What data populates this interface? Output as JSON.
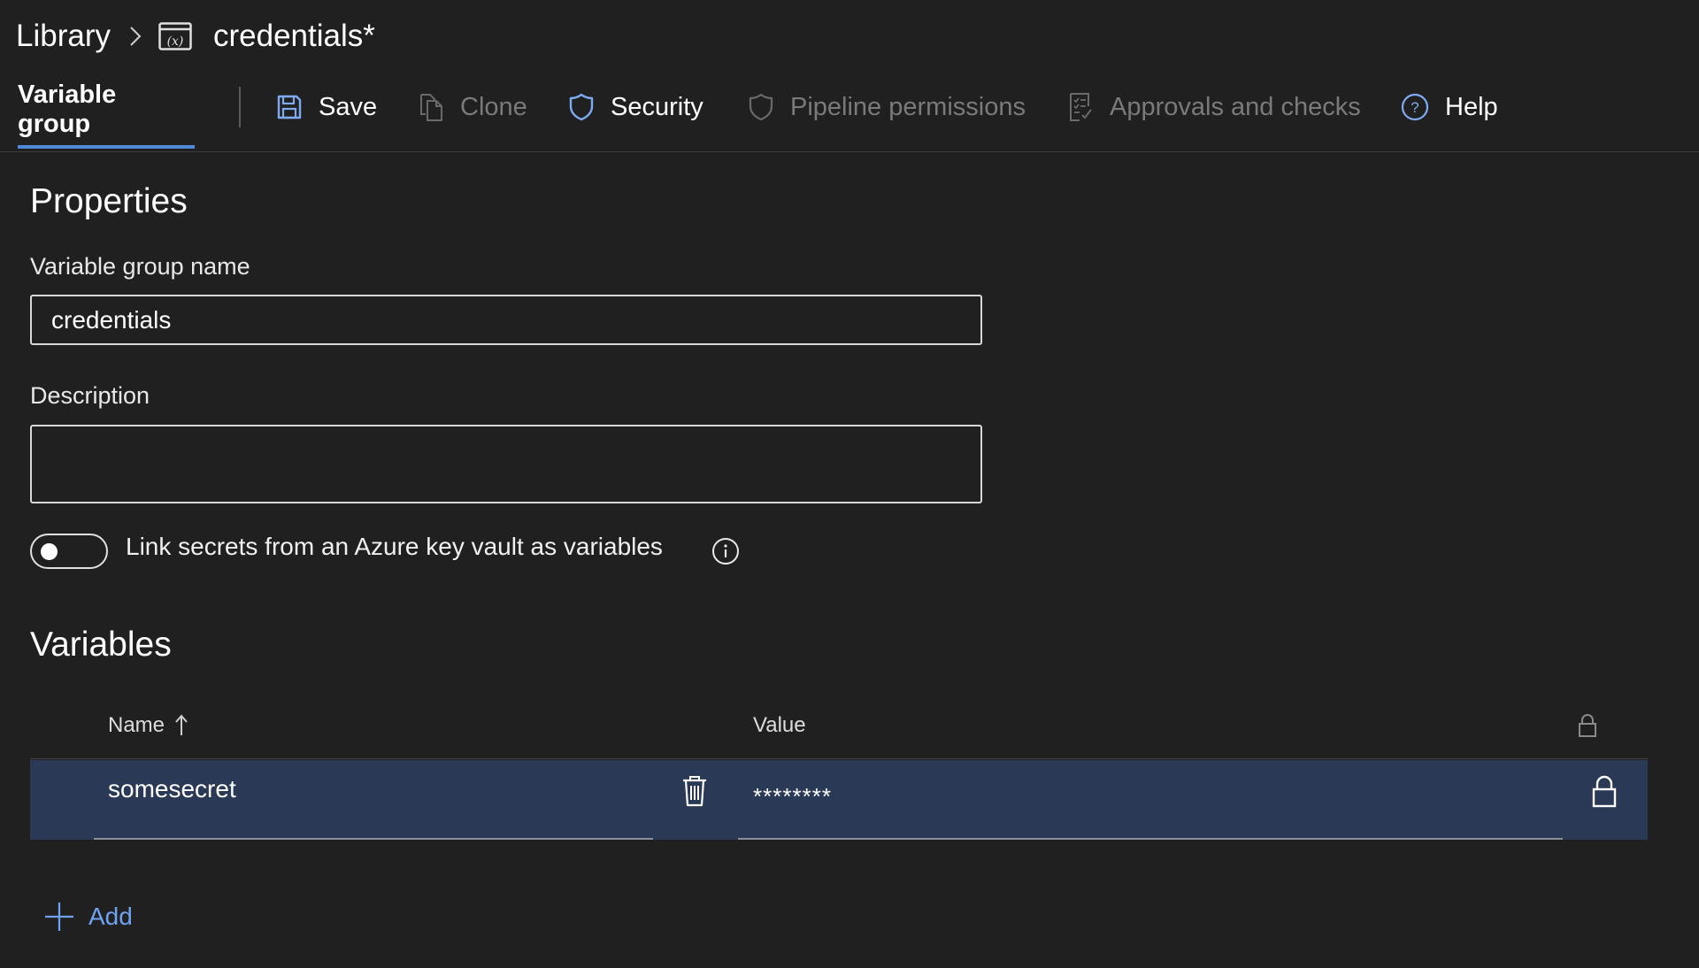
{
  "breadcrumb": {
    "root": "Library",
    "current": "credentials*",
    "separator_icon": "chevron-right-icon",
    "group_icon": "variable-group-icon"
  },
  "toolbar": {
    "active_tab": "Variable group",
    "save": "Save",
    "clone": "Clone",
    "security": "Security",
    "pipeline_permissions": "Pipeline permissions",
    "approvals": "Approvals and checks",
    "help": "Help"
  },
  "properties": {
    "title": "Properties",
    "name_label": "Variable group name",
    "name_value": "credentials",
    "description_label": "Description",
    "description_value": "",
    "keyvault_toggle_label": "Link secrets from an Azure key vault as variables",
    "keyvault_toggle_on": false
  },
  "variables": {
    "title": "Variables",
    "columns": {
      "name": "Name",
      "value": "Value"
    },
    "rows": [
      {
        "name": "somesecret",
        "value": "********",
        "secret": true
      }
    ],
    "add_label": "Add"
  },
  "colors": {
    "background": "#202020",
    "accent": "#4f8ad8",
    "link": "#6fa3f2",
    "selected_row": "#293956",
    "disabled_text": "#7a7a7a"
  }
}
